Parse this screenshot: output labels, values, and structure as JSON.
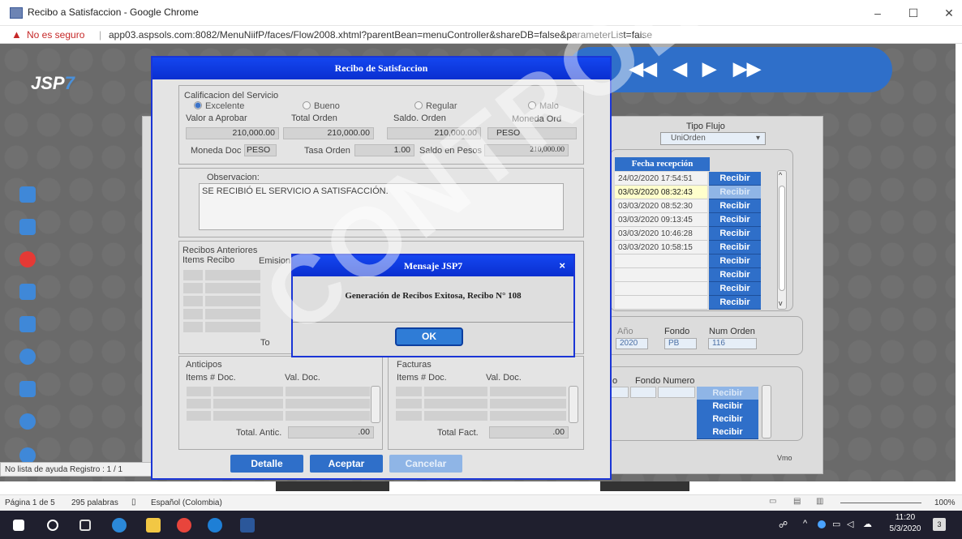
{
  "window": {
    "title": "Recibo a Satisfaccion - Google Chrome",
    "minimize": "–",
    "maximize": "☐",
    "close": "✕"
  },
  "address": {
    "security": "No es seguro",
    "url": "app03.aspsols.com:8082/MenuNiifP/faces/Flow2008.xhtml?parentBean=menuController&shareDB=false&parameterList=false"
  },
  "app": {
    "logo_main": "JSP",
    "logo_suffix": "7",
    "nav": [
      "◀◀",
      "◀",
      "▶",
      "▶▶"
    ],
    "tipo_flujo_label": "Tipo Flujo",
    "tipo_flujo_value": "UniOrden",
    "fecha_header": "Fecha recepción",
    "recepciones": [
      {
        "fecha": "24/02/2020 17:54:51",
        "btn": "Recibir",
        "hl": false,
        "dim": false
      },
      {
        "fecha": "03/03/2020 08:32:43",
        "btn": "Recibir",
        "hl": true,
        "dim": true
      },
      {
        "fecha": "03/03/2020 08:52:30",
        "btn": "Recibir",
        "hl": false,
        "dim": false
      },
      {
        "fecha": "03/03/2020 09:13:45",
        "btn": "Recibir",
        "hl": false,
        "dim": false
      },
      {
        "fecha": "03/03/2020 10:46:28",
        "btn": "Recibir",
        "hl": false,
        "dim": false
      },
      {
        "fecha": "03/03/2020 10:58:15",
        "btn": "Recibir",
        "hl": false,
        "dim": false
      },
      {
        "fecha": "",
        "btn": "Recibir",
        "hl": false,
        "dim": false
      },
      {
        "fecha": "",
        "btn": "Recibir",
        "hl": false,
        "dim": false
      },
      {
        "fecha": "",
        "btn": "Recibir",
        "hl": false,
        "dim": false
      },
      {
        "fecha": "",
        "btn": "Recibir",
        "hl": false,
        "dim": false
      }
    ],
    "ano_label": "Año",
    "ano_value": "2020",
    "fondo_label": "Fondo",
    "fondo_value": "PB",
    "numorden_label": "Num Orden",
    "numorden_value": "116",
    "col_o": "o",
    "fondo_numero_label": "Fondo Numero",
    "lower_buttons": [
      {
        "label": "Recibir",
        "dim": true
      },
      {
        "label": "Recibir",
        "dim": false
      },
      {
        "label": "Recibir",
        "dim": false
      },
      {
        "label": "Recibir",
        "dim": false
      }
    ],
    "vmo": "Vmo",
    "status": "No lista de ayuda   Registro : 1 / 1"
  },
  "dialog": {
    "title": "Recibo de Satisfaccion",
    "calificacion_title": "Calificacion del Servicio",
    "radios": [
      "Excelente",
      "Bueno",
      "Regular",
      "Malo"
    ],
    "selected_radio": "Excelente",
    "valor_aprobar_label": "Valor a Aprobar",
    "valor_aprobar": "210,000.00",
    "total_orden_label": "Total Orden",
    "total_orden": "210,000.00",
    "saldo_orden_label": "Saldo. Orden",
    "saldo_orden": "210,000.00",
    "moneda_ord_label": "Moneda Ord",
    "moneda_ord": "PESO",
    "moneda_doc_label": "Moneda Doc",
    "moneda_doc": "PESO",
    "tasa_orden_label": "Tasa Orden",
    "tasa_orden": "1.00",
    "saldo_pesos_label": "Saldo en Pesos",
    "saldo_pesos": "210,000.00",
    "observacion_label": "Observacion:",
    "observacion": "SE RECIBIÓ EL SERVICIO A SATISFACCIÓN.",
    "recibos_title": "Recibos Anteriores",
    "recibos_cols": [
      "Items Recibo",
      "Emision"
    ],
    "recibos_total": "To",
    "anticipos_title": "Anticipos",
    "anticipos_cols": [
      "Items  # Doc.",
      "Val. Doc."
    ],
    "anticipos_total_label": "Total. Antic.",
    "anticipos_total": ".00",
    "facturas_title": "Facturas",
    "facturas_cols": [
      "Items  # Doc.",
      "Val. Doc."
    ],
    "facturas_total_label": "Total Fact.",
    "facturas_total": ".00",
    "btn_detalle": "Detalle",
    "btn_aceptar": "Aceptar",
    "btn_cancelar": "Cancelar"
  },
  "message": {
    "title": "Mensaje JSP7",
    "close": "×",
    "text": "Generación de Recibos Exitosa, Recibo N° 108",
    "ok": "OK"
  },
  "word": {
    "page": "Página 1 de 5",
    "words": "295 palabras",
    "lang": "Español (Colombia)",
    "zoom": "100%"
  },
  "taskbar": {
    "time": "11:20",
    "date": "5/3/2020",
    "notif": "3"
  },
  "watermark": "CONTROLADA"
}
